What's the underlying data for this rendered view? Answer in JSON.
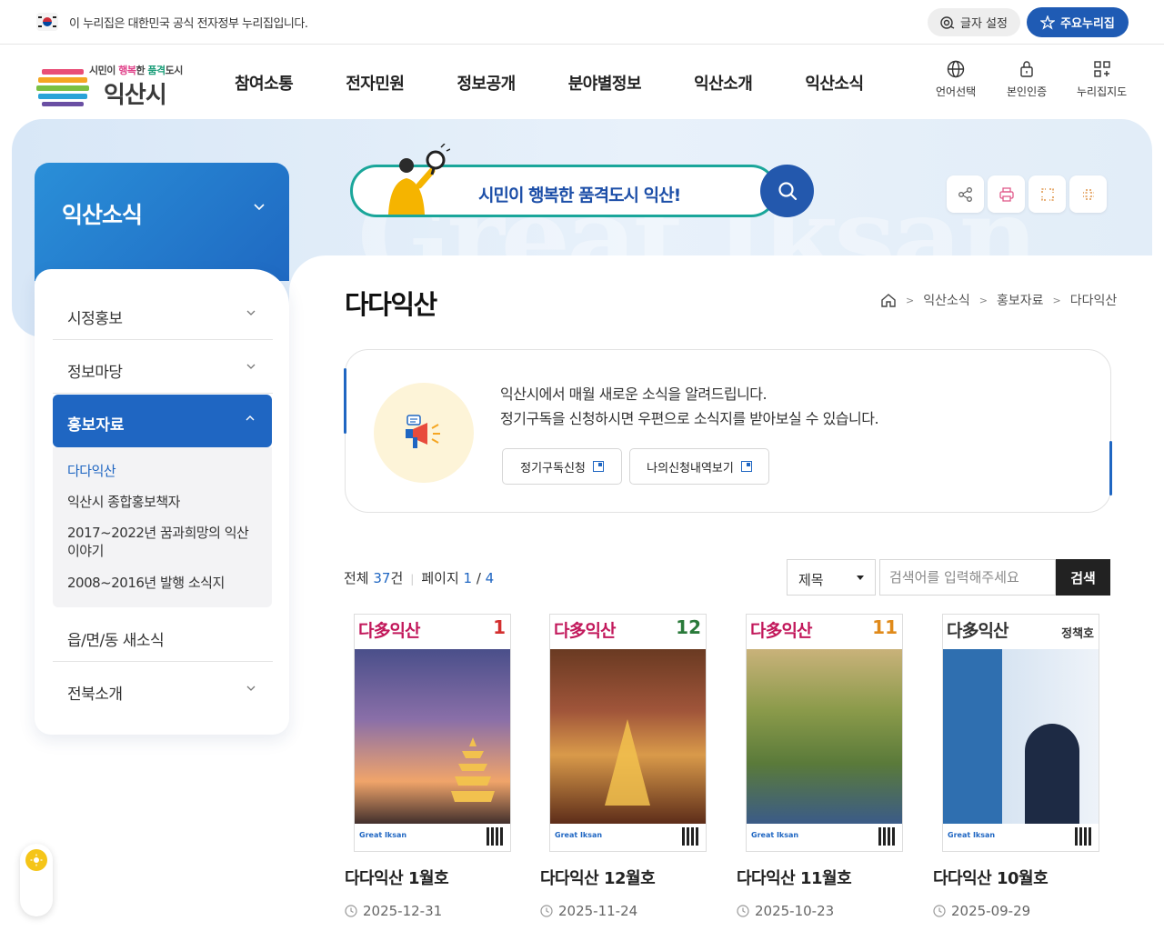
{
  "gov_bar": {
    "notice": "이 누리집은 대한민국 공식 전자정부 누리집입니다.",
    "font_setting": "글자 설정",
    "main_sites": "주요누리집"
  },
  "header": {
    "logo_tagline_1": "시민이 ",
    "logo_tagline_2": "행복",
    "logo_tagline_3": "한 ",
    "logo_tagline_4": "품격",
    "logo_tagline_5": "도시",
    "logo_name": "익산시",
    "gnb": [
      "참여소통",
      "전자민원",
      "정보공개",
      "분야별정보",
      "익산소개",
      "익산소식"
    ],
    "util": {
      "language": "언어선택",
      "auth": "본인인증",
      "sitemap": "누리집지도"
    }
  },
  "hero": {
    "ghost_text": "Great Iksan",
    "search_slogan": "시민이 행복한 품격도시 익산!"
  },
  "lnb": {
    "title": "익산소식",
    "items": [
      "시정홍보",
      "정보마당"
    ],
    "active": "홍보자료",
    "sub_items": [
      "다다익산",
      "익산시 종합홍보책자",
      "2017~2022년 꿈과희망의 익산이야기",
      "2008~2016년 발행 소식지"
    ],
    "items_after": [
      "읍/면/동 새소식",
      "전북소개"
    ]
  },
  "page": {
    "title": "다다익산",
    "breadcrumb": [
      "익산소식",
      "홍보자료",
      "다다익산"
    ]
  },
  "info": {
    "line1": "익산시에서 매월 새로운 소식을 알려드립니다.",
    "line2": "정기구독을 신청하시면 우편으로 소식지를 받아보실 수 있습니다.",
    "btn_subscribe": "정기구독신청",
    "btn_history": "나의신청내역보기"
  },
  "list": {
    "total_label": "전체",
    "total_count": "37",
    "total_unit": "건",
    "page_label": "페이지",
    "page_current": "1",
    "page_sep": " / ",
    "page_total": "4",
    "select_value": "제목",
    "search_placeholder": "검색어를 입력해주세요",
    "search_button": "검색"
  },
  "cards": [
    {
      "title": "다다익산 1월호",
      "date": "2025-12-31",
      "brand": "다多익산",
      "issue": "1",
      "theme": "#4a3f7a"
    },
    {
      "title": "다다익산 12월호",
      "date": "2025-11-24",
      "brand": "다多익산",
      "issue": "12",
      "theme": "#8a3a22"
    },
    {
      "title": "다다익산 11월호",
      "date": "2025-10-23",
      "brand": "다多익산",
      "issue": "11",
      "theme": "#6b7a3a"
    },
    {
      "title": "다다익산 10월호",
      "date": "2025-09-29",
      "brand": "다多익산",
      "issue": "정책호",
      "theme": "#2f6fb0"
    }
  ],
  "colors": {
    "primary": "#1f66c2",
    "teal": "#1aa69a",
    "gov_button": "#1f5bb4"
  }
}
